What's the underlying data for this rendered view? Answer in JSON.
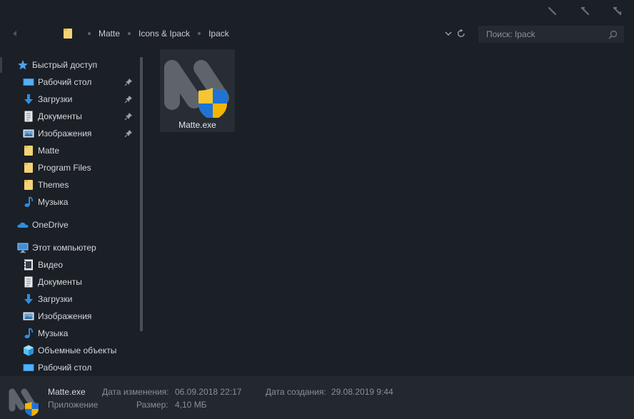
{
  "address": {
    "breadcrumbs": [
      "Matte",
      "Icons & Ipack",
      "Ipack"
    ],
    "search_placeholder": "Поиск: Ipack"
  },
  "sidebar": {
    "quick_access": {
      "label": "Быстрый доступ",
      "items": [
        {
          "label": "Рабочий стол",
          "icon": "desktop-icon",
          "pinned": true
        },
        {
          "label": "Загрузки",
          "icon": "download-icon",
          "pinned": true
        },
        {
          "label": "Документы",
          "icon": "document-icon",
          "pinned": true
        },
        {
          "label": "Изображения",
          "icon": "pictures-icon",
          "pinned": true
        },
        {
          "label": "Matte",
          "icon": "folder-icon",
          "pinned": false
        },
        {
          "label": "Program Files",
          "icon": "folder-icon",
          "pinned": false
        },
        {
          "label": "Themes",
          "icon": "folder-icon",
          "pinned": false
        },
        {
          "label": "Музыка",
          "icon": "music-icon",
          "pinned": false
        }
      ]
    },
    "onedrive": {
      "label": "OneDrive"
    },
    "this_pc": {
      "label": "Этот компьютер",
      "items": [
        {
          "label": "Видео",
          "icon": "video-icon"
        },
        {
          "label": "Документы",
          "icon": "document-icon"
        },
        {
          "label": "Загрузки",
          "icon": "download-icon"
        },
        {
          "label": "Изображения",
          "icon": "pictures-icon"
        },
        {
          "label": "Музыка",
          "icon": "music-icon"
        },
        {
          "label": "Объемные объекты",
          "icon": "3d-objects-icon"
        },
        {
          "label": "Рабочий стол",
          "icon": "desktop-icon"
        }
      ]
    }
  },
  "files": [
    {
      "name": "Matte.exe",
      "icon": "matte-app-shield-icon"
    }
  ],
  "details": {
    "name": "Matte.exe",
    "type": "Приложение",
    "modified_label": "Дата изменения:",
    "modified_value": "06.09.2018 22:17",
    "created_label": "Дата создания:",
    "created_value": "29.08.2019 9:44",
    "size_label": "Размер:",
    "size_value": "4,10 МБ"
  },
  "colors": {
    "background": "#1b1f26",
    "tile_selected": "#272c35",
    "details_bg": "#23272e",
    "folder_yellow": "#f5d374",
    "accent_blue": "#1f8fe0"
  }
}
